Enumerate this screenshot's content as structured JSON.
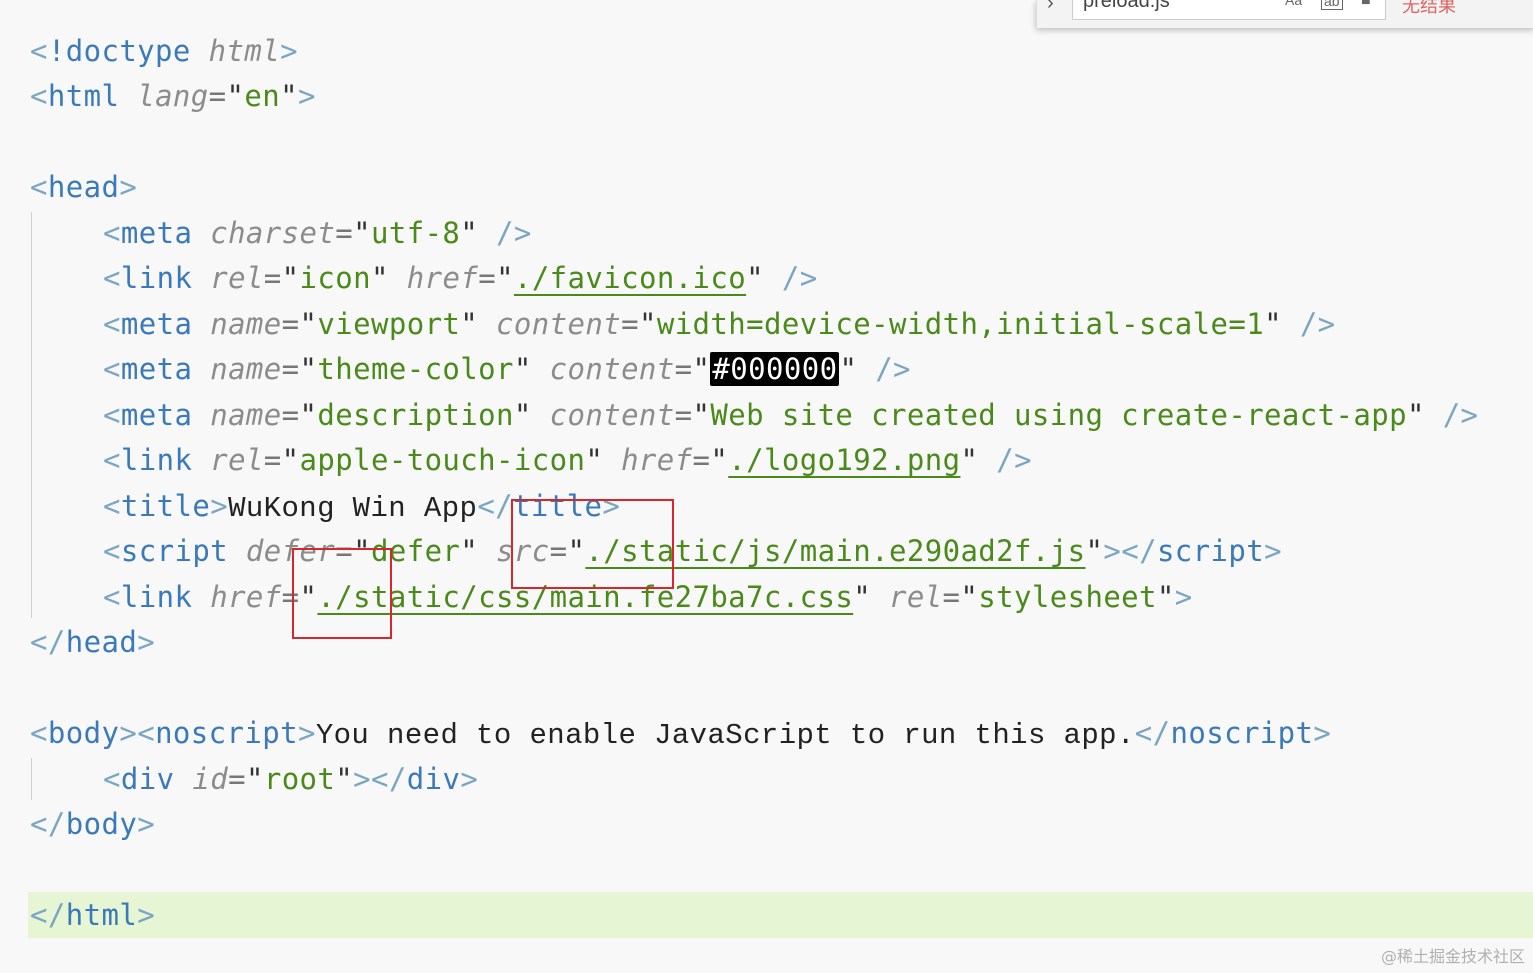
{
  "find_widget": {
    "query": "preload.js",
    "match_case_label": "Aa",
    "match_word_label": "ab",
    "result_text": "无结果"
  },
  "code": {
    "l1": {
      "tag": "!doctype",
      "attr": "html"
    },
    "l2": {
      "tag": "html",
      "attr": "lang",
      "value": "en"
    },
    "l4": {
      "tag": "head"
    },
    "l5": {
      "tag": "meta",
      "attr": "charset",
      "value": "utf-8"
    },
    "l6": {
      "tag": "link",
      "attr1": "rel",
      "value1": "icon",
      "attr2": "href",
      "value2": "./favicon.ico"
    },
    "l7": {
      "tag": "meta",
      "attr1": "name",
      "value1": "viewport",
      "attr2": "content",
      "value2": "width=device-width,initial-scale=1"
    },
    "l8": {
      "tag": "meta",
      "attr1": "name",
      "value1": "theme-color",
      "attr2": "content",
      "value2": "#000000"
    },
    "l9": {
      "tag": "meta",
      "attr1": "name",
      "value1": "description",
      "attr2": "content",
      "value2": "Web site created using create-react-app"
    },
    "l10": {
      "tag": "link",
      "attr1": "rel",
      "value1": "apple-touch-icon",
      "attr2": "href",
      "value2": "./logo192.png"
    },
    "l11": {
      "tag": "title",
      "text": "WuKong Win App"
    },
    "l12": {
      "tag": "script",
      "attr1": "defer",
      "value1": "defer",
      "attr2": "src",
      "value2": "./static/js/main.e290ad2f.js"
    },
    "l13": {
      "tag": "link",
      "attr1": "href",
      "value1": "./static/css/main.fe27ba7c.css",
      "attr2": "rel",
      "value2": "stylesheet"
    },
    "l14": {
      "tag": "head"
    },
    "l16": {
      "tag1": "body",
      "tag2": "noscript",
      "text": "You need to enable JavaScript to run this app."
    },
    "l17": {
      "tag": "div",
      "attr": "id",
      "value": "root"
    },
    "l18": {
      "tag": "body"
    },
    "l20": {
      "tag": "html"
    }
  },
  "watermark": "@稀土掘金技术社区",
  "colors": {
    "tag": "#3a79ba",
    "punct": "#7aa6c2",
    "attr": "#8c8c8c",
    "value": "#4a8a1a",
    "highlight_line": "#e6f5d4",
    "annotation_box": "#d9262c"
  }
}
